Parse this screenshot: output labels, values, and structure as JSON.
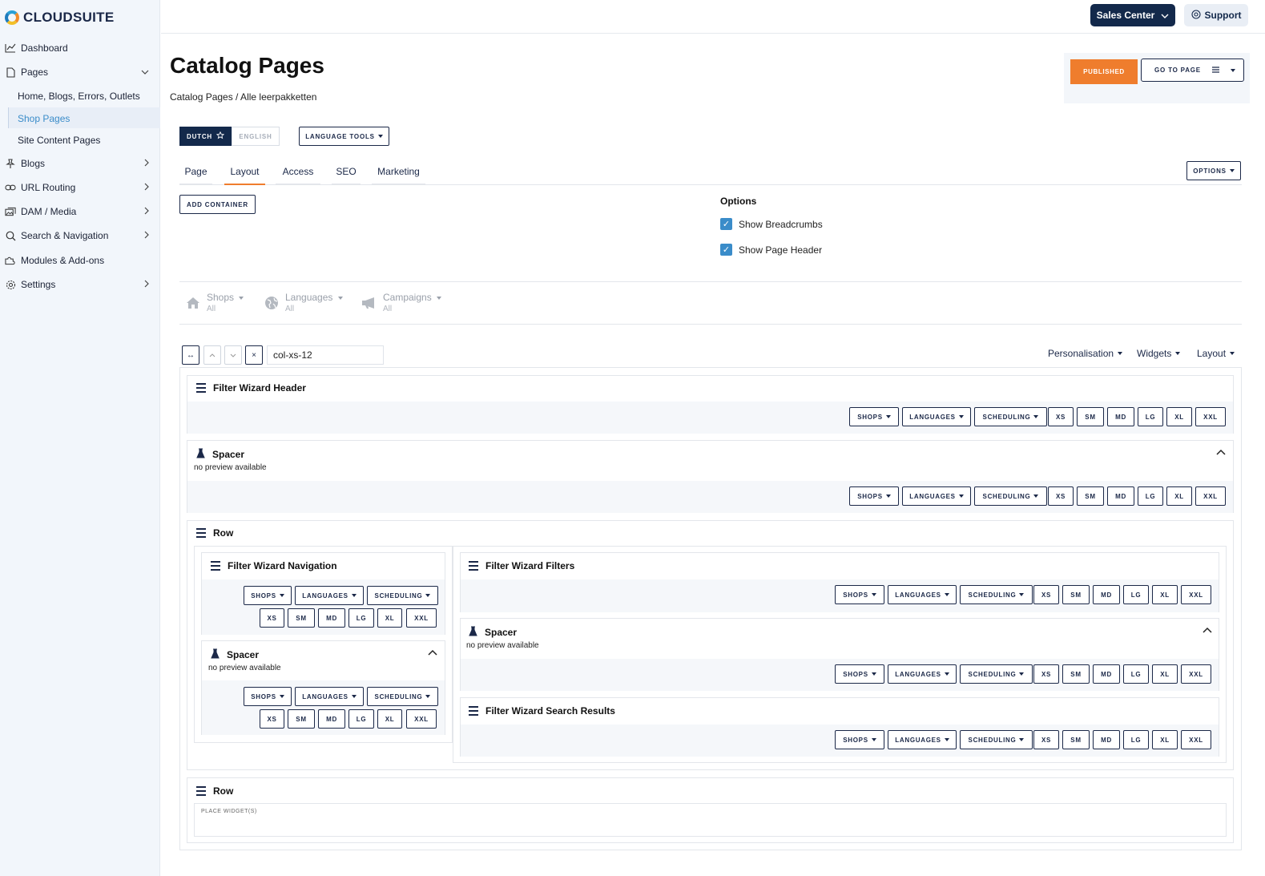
{
  "brand": {
    "name": "CLOUDSUITE"
  },
  "sidebar": {
    "items": [
      {
        "label": "Dashboard",
        "icon": "chart-line-icon"
      },
      {
        "label": "Pages",
        "icon": "document-icon"
      },
      {
        "label": "Blogs",
        "icon": "pin-icon"
      },
      {
        "label": "URL Routing",
        "icon": "link-icon"
      },
      {
        "label": "DAM / Media",
        "icon": "images-icon"
      },
      {
        "label": "Search & Navigation",
        "icon": "search-icon"
      },
      {
        "label": "Modules & Add-ons",
        "icon": "puzzle-icon"
      },
      {
        "label": "Settings",
        "icon": "gear-icon"
      }
    ],
    "pages_children": [
      "Home, Blogs, Errors, Outlets",
      "Shop Pages",
      "Site Content Pages"
    ]
  },
  "topbar": {
    "sales_center": "Sales Center",
    "support": "Support"
  },
  "header": {
    "title": "Catalog Pages",
    "breadcrumb": "Catalog Pages / Alle leerpakketten",
    "published": "PUBLISHED",
    "go_to_page": "GO TO PAGE"
  },
  "language": {
    "dutch": "DUTCH",
    "english": "ENGLISH",
    "tools": "LANGUAGE TOOLS"
  },
  "tabs": [
    "Page",
    "Layout",
    "Access",
    "SEO",
    "Marketing"
  ],
  "options_button": "OPTIONS",
  "add_container": "ADD CONTAINER",
  "options": {
    "title": "Options",
    "show_breadcrumbs": "Show Breadcrumbs",
    "show_page_header": "Show Page Header"
  },
  "filters": [
    {
      "label": "Shops",
      "value": "All",
      "icon": "home-icon"
    },
    {
      "label": "Languages",
      "value": "All",
      "icon": "globe-icon"
    },
    {
      "label": "Campaigns",
      "value": "All",
      "icon": "megaphone-icon"
    }
  ],
  "toolbar": {
    "col_class": "col-xs-12",
    "personalisation": "Personalisation",
    "widgets": "Widgets",
    "layout": "Layout"
  },
  "widget_buttons": {
    "shops": "SHOPS",
    "languages": "LANGUAGES",
    "scheduling": "SCHEDULING",
    "sizes": [
      "XS",
      "SM",
      "MD",
      "LG",
      "XL",
      "XXL"
    ]
  },
  "widgets": {
    "filter_wizard_header": "Filter Wizard Header",
    "spacer": "Spacer",
    "no_preview": "no preview available",
    "row": "Row",
    "filter_wizard_navigation": "Filter Wizard Navigation",
    "filter_wizard_filters": "Filter Wizard Filters",
    "filter_wizard_search_results": "Filter Wizard Search Results",
    "place_widgets": "PLACE WIDGET(S)"
  },
  "colors": {
    "navy": "#13294b",
    "accent_orange": "#ef7d2d",
    "link_blue": "#3a8cc9"
  }
}
